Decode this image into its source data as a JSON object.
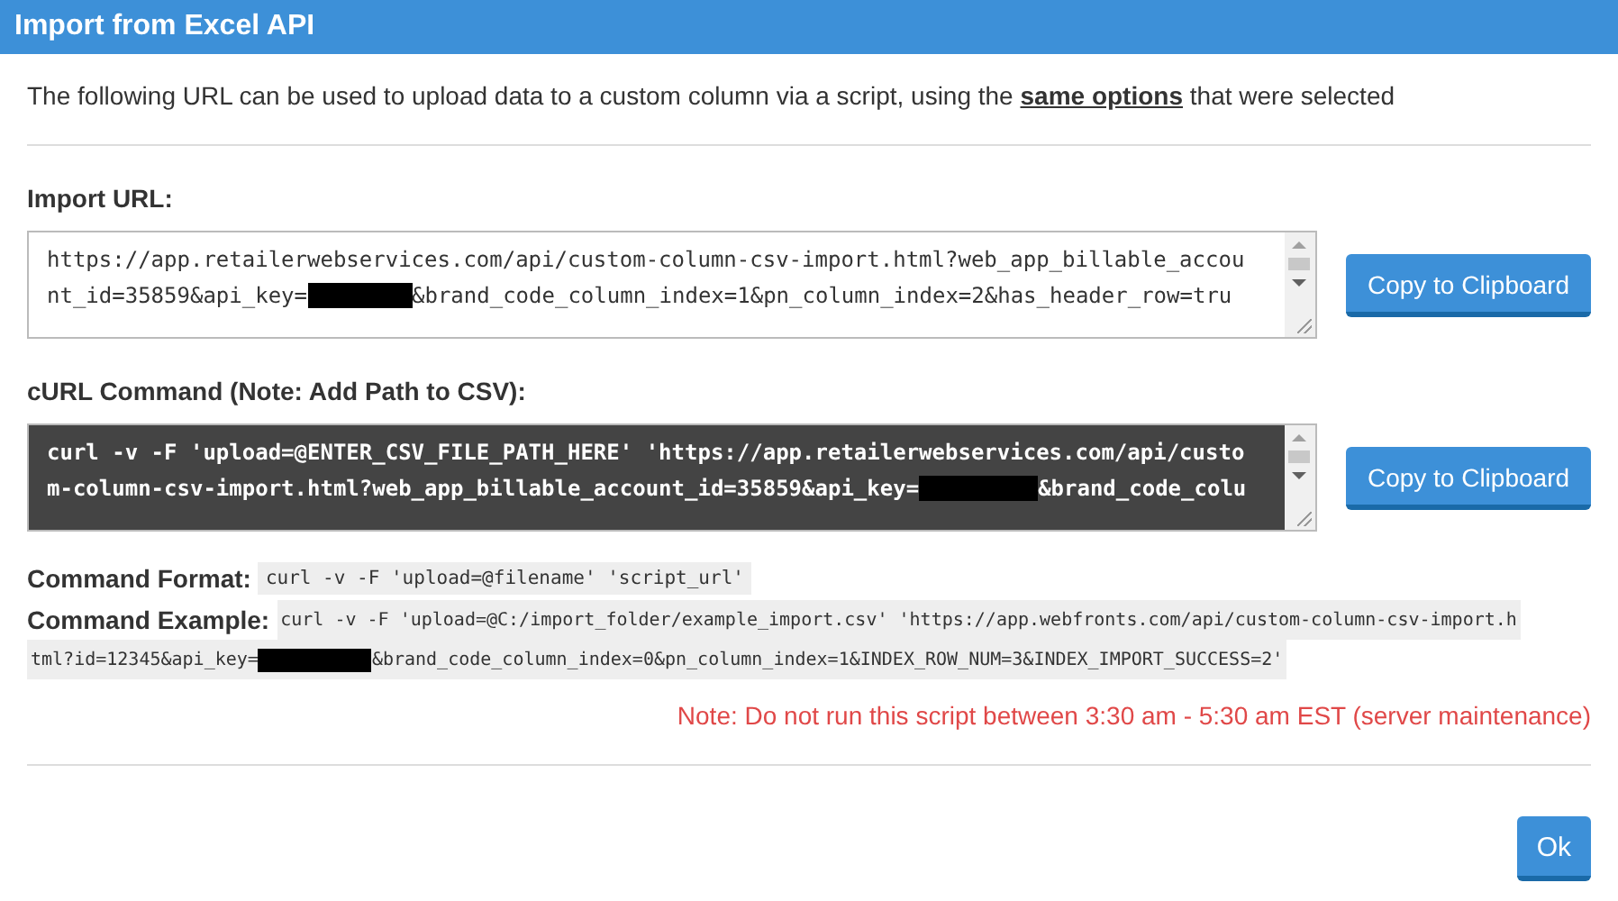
{
  "window": {
    "title": "Import from Excel API"
  },
  "intro": "The following URL can be used to upload data to a custom column via a script, using the **same options** that were selected",
  "sections": [
    {
      "label": "Import URL:",
      "kind": "light",
      "lines": [
        [
          {
            "kind": "text",
            "text": "https://app.retailerwebservices.com/api/custom-column-csv-import.html?web_app_billable_accou"
          }
        ],
        [
          {
            "kind": "text",
            "text": "nt_id=35859&api_key="
          },
          {
            "kind": "redaction"
          },
          {
            "kind": "text",
            "text": "&brand_code_column_index=1&pn_column_index=2&has_header_row=tru"
          }
        ]
      ],
      "button": "Copy to Clipboard"
    },
    {
      "label": "cURL Command (Note: Add Path to CSV):",
      "kind": "dark",
      "lines": [
        [
          {
            "kind": "text",
            "text": "curl -v -F 'upload=@ENTER_CSV_FILE_PATH_HERE' 'https://app.retailerwebservices.com/api/custo"
          }
        ],
        [
          {
            "kind": "text",
            "text": "m-column-csv-import.html?web_app_billable_account_id=35859&api_key="
          },
          {
            "kind": "redaction"
          },
          {
            "kind": "text",
            "text": "&brand_code_colu"
          }
        ]
      ],
      "button": "Copy to Clipboard"
    }
  ],
  "command_format": {
    "label": "Command Format:",
    "code": "curl -v -F 'upload=@filename' 'script_url'"
  },
  "command_example": {
    "label": "Command Example:",
    "lines": [
      [
        {
          "kind": "text",
          "text": "curl -v -F 'upload=@C:/import_folder/example_import.csv' 'https://app.webfronts.com/api/custom-column-csv-import.h"
        }
      ],
      [
        {
          "kind": "text",
          "text": "tml?id=12345&api_key="
        },
        {
          "kind": "redaction"
        },
        {
          "kind": "text",
          "text": "&brand_code_column_index=0&pn_column_index=1&INDEX_ROW_NUM=3&INDEX_IMPORT_SUCCESS=2'"
        }
      ]
    ]
  },
  "note": "Note: Do not run this script between 3:30 am - 5:30 am EST (server maintenance)",
  "ok_button": "Ok"
}
